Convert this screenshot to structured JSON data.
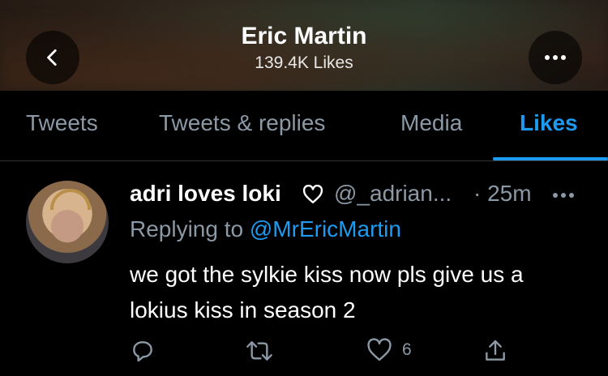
{
  "header": {
    "name": "Eric Martin",
    "likes_count": "139.4K Likes",
    "back_icon": "chevron-left-icon",
    "more_icon": "more-horizontal-icon"
  },
  "tabs": [
    {
      "label": "Tweets",
      "active": false
    },
    {
      "label": "Tweets & replies",
      "active": false
    },
    {
      "label": "Media",
      "active": false
    },
    {
      "label": "Likes",
      "active": true
    }
  ],
  "tweet": {
    "author_name": "adri loves loki",
    "name_icon": "heart-outline-icon",
    "handle": "@_adrian...",
    "time": "· 25m",
    "replying_prefix": "Replying to",
    "replying_to": "@MrEricMartin",
    "text": "we got the sylkie kiss now pls give us a lokius kiss in season 2",
    "actions": {
      "reply_icon": "reply-icon",
      "retweet_icon": "retweet-icon",
      "like_icon": "heart-outline-icon",
      "like_count": "6",
      "share_icon": "share-icon"
    }
  },
  "colors": {
    "accent": "#1d9bf0",
    "muted": "#8b98a5",
    "background": "#000000"
  }
}
